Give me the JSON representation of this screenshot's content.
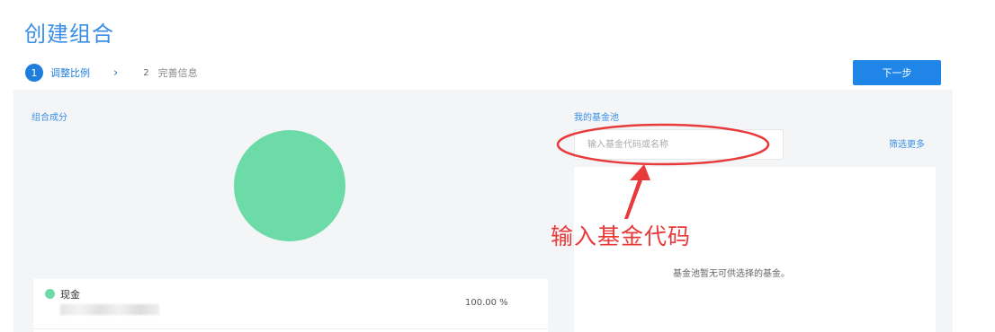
{
  "header": {
    "title": "创建组合"
  },
  "steps": [
    {
      "number": "1",
      "label": "调整比例",
      "active": true
    },
    {
      "number": "2",
      "label": "完善信息",
      "active": false
    }
  ],
  "toolbar": {
    "next_label": "下一步"
  },
  "left_panel": {
    "title": "组合成分",
    "chart_data": {
      "type": "pie",
      "categories": [
        "现金"
      ],
      "values": [
        100
      ],
      "colors": [
        "#6ddba8"
      ]
    },
    "holding": {
      "name": "现金",
      "percent": "100.00 %",
      "color": "#6ddba8"
    }
  },
  "right_panel": {
    "title": "我的基金池",
    "search_placeholder": "输入基金代码或名称",
    "filter_label": "筛选更多",
    "empty_text": "基金池暂无可供选择的基金。"
  },
  "annotation": {
    "text": "输入基金代码",
    "color": "#e83a3a"
  },
  "colors": {
    "accent": "#1f86e8",
    "link": "#3a8ee6",
    "pie": "#6ddba8",
    "panel_bg": "#f4f5f7"
  }
}
